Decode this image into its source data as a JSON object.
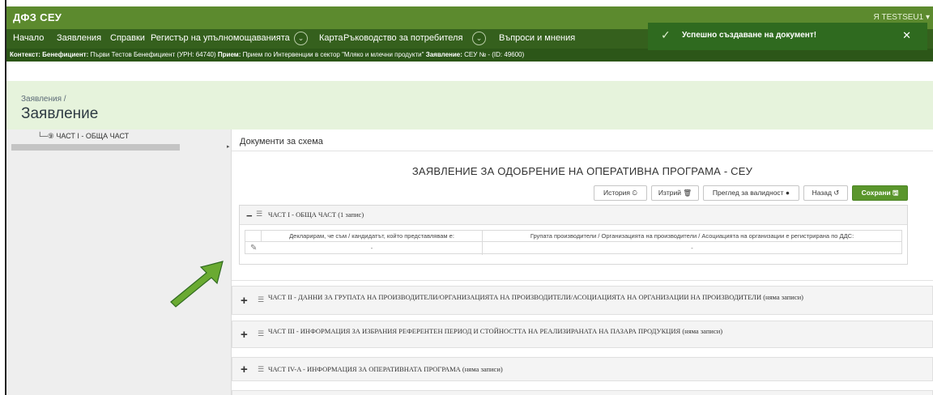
{
  "app": {
    "brand": "ДФЗ СЕУ",
    "user": "Я TESTSEU1 ▾"
  },
  "nav": {
    "items": [
      "Начало",
      "Заявления",
      "Справки",
      "Регистър на упълномощаванията",
      "Карта",
      "Ръководство за потребителя",
      "Въпроси и мнения"
    ],
    "dropdown_glyph": "⌄"
  },
  "context": {
    "label1": "Контекст:",
    "label2": "Бенефициент:",
    "text2": "Първи Тестов Бенефициент (УРН: 64740)",
    "label3": "Прием:",
    "text3": "Прием по Интервенции в сектор \"Мляко и млечни продукти\"",
    "label4": "Заявление:",
    "text4": "СЕУ № - (ID: 49600)"
  },
  "toast": {
    "check": "✓",
    "text": "Успешно създаване на документ!",
    "close": "✕"
  },
  "header": {
    "breadcrumb": "Заявления /",
    "title": "Заявление"
  },
  "sidebar": {
    "tree_item": "└─⑨ ЧАСТ I - ОБЩА ЧАСТ"
  },
  "main": {
    "section_label": "Документи за схема",
    "form_title": "ЗАЯВЛЕНИЕ ЗА ОДОБРЕНИЕ НА ОПЕРАТИВНА ПРОГРАМА - СЕУ",
    "buttons": {
      "history": "История ⏲",
      "delete": "Изтрий 🗑",
      "validity": "Преглед за валидност ●",
      "back": "Назад ↺",
      "save": "Сохрани 🖫"
    },
    "part1": {
      "title": "ЧАСТ I - ОБЩА ЧАСТ (1 запис)",
      "col1": "Декларирам, че съм / кандидатът, който представлявам е:",
      "col2": "Групата производители / Организацията на производители / Асоциацията на организации е регистрирана по ДДС:",
      "val1": "-",
      "val2": "-"
    },
    "parts": [
      {
        "title": "ЧАСТ II - ДАННИ ЗА ГРУПАТА НА ПРОИЗВОДИТЕЛИ/ОРГАНИЗАЦИЯТА НА ПРОИЗВОДИТЕЛИ/АСОЦИАЦИЯТА НА ОРГАНИЗАЦИИ НА ПРОИЗВОДИТЕЛИ (няма записи)"
      },
      {
        "title": "ЧАСТ III - ИНФОРМАЦИЯ ЗА ИЗБРАНИЯ РЕФЕРЕНТЕН ПЕРИОД И СТОЙНОСТТА НА РЕАЛИЗИРАНАТА НА ПАЗАРА ПРОДУКЦИЯ (няма записи)"
      },
      {
        "title": "ЧАСТ IV-A - ИНФОРМАЦИЯ ЗА ОПЕРАТИВНАТА ПРОГРАМА (няма записи)"
      }
    ]
  },
  "colors": {
    "topbar": "#5c8a2e",
    "navbar": "#35601d",
    "context": "#2c5618",
    "toast": "#2f6a1f",
    "title_band": "#e6f3dc",
    "save": "#5a962c",
    "arrow": "#6aaa32"
  }
}
